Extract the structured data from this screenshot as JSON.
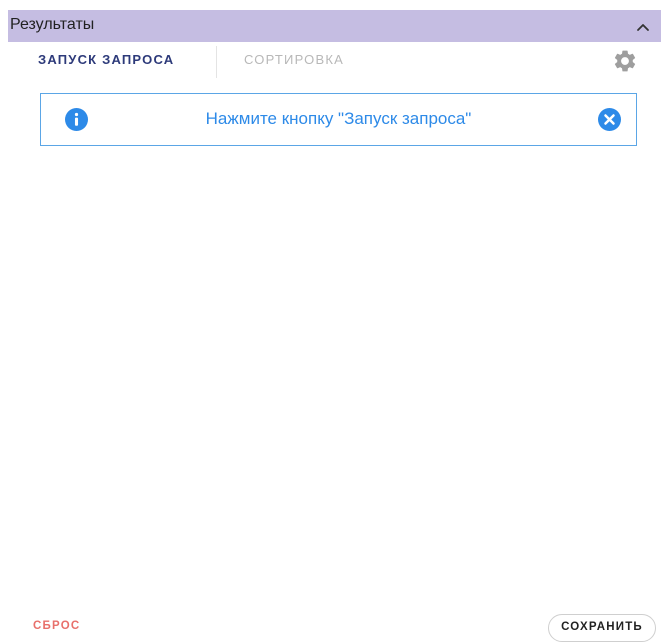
{
  "panel": {
    "title": "Результаты",
    "collapse_icon": "chevron-up-icon",
    "header_color": "#c5bde2"
  },
  "tabs": [
    {
      "label": "ЗАПУСК ЗАПРОСА",
      "active": true
    },
    {
      "label": "СОРТИРОВКА",
      "active": false
    }
  ],
  "settings_icon": "gear-icon",
  "info_banner": {
    "icon": "info-icon",
    "message": "Нажмите кнопку \"Запуск запроса\"",
    "close_icon": "close-circle-icon",
    "accent_color": "#2d8ae8"
  },
  "footer": {
    "reset_label": "СБРОС",
    "save_label": "СОХРАНИТЬ",
    "reset_color": "#e8706b"
  }
}
